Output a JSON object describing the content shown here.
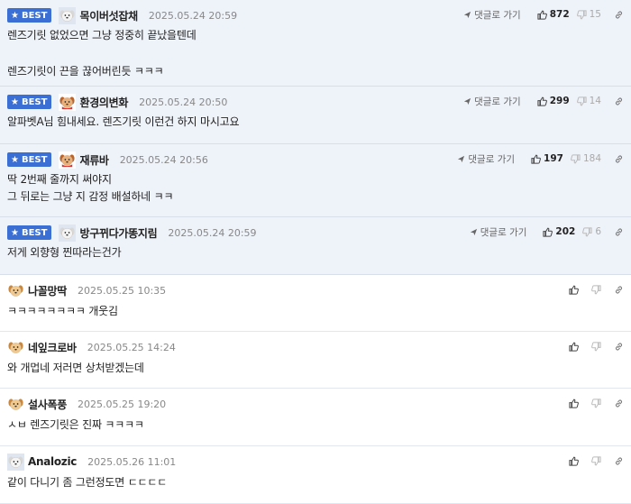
{
  "reply_label": "댓글로 가기",
  "best_label": "BEST",
  "comments": [
    {
      "type": "best",
      "author": "목이버섯잡채",
      "date": "2025.05.24 20:59",
      "up": "872",
      "down": "15",
      "avatar": "white-dog",
      "lines": [
        "렌즈기릿 없었으면 그냥 정중히 끝났을텐데",
        "",
        "렌즈기릿이 끈을 끊어버린듯 ㅋㅋㅋ"
      ]
    },
    {
      "type": "best",
      "author": "환경의변화",
      "date": "2025.05.24 20:50",
      "up": "299",
      "down": "14",
      "avatar": "red-dog",
      "lines": [
        "알파벳A님 힘내세요. 렌즈기릿 이런건 하지 마시고요"
      ]
    },
    {
      "type": "best",
      "author": "재류바",
      "date": "2025.05.24 20:56",
      "up": "197",
      "down": "184",
      "avatar": "red-dog",
      "lines": [
        "딱 2번째 줄까지 써야지",
        "그 뒤로는 그냥 지 감정 배설하네 ㅋㅋ"
      ]
    },
    {
      "type": "best",
      "author": "방구뀌다가똥지림",
      "date": "2025.05.24 20:59",
      "up": "202",
      "down": "6",
      "avatar": "white-dog",
      "lines": [
        "저게 외향형 찐따라는건가"
      ]
    },
    {
      "type": "normal",
      "author": "나꼴망딱",
      "date": "2025.05.25 10:35",
      "avatar": "tan-dog",
      "lines": [
        "ㅋㅋㅋㅋㅋㅋㅋㅋ 개웃김"
      ]
    },
    {
      "type": "normal",
      "author": "네잎크로바",
      "date": "2025.05.25 14:24",
      "avatar": "tan-dog",
      "lines": [
        "와 개멉네 저러면 상처받겠는데"
      ]
    },
    {
      "type": "normal",
      "author": "설사폭풍",
      "date": "2025.05.25 19:20",
      "avatar": "tan-dog",
      "lines": [
        "ㅅㅂ 렌즈기릿은 진짜 ㅋㅋㅋㅋ"
      ]
    },
    {
      "type": "normal",
      "author": "Analozic",
      "date": "2025.05.26 11:01",
      "avatar": "white-dog",
      "lines": [
        "같이 다니기 좀 그런정도면 ㄷㄷㄷㄷ"
      ]
    }
  ]
}
